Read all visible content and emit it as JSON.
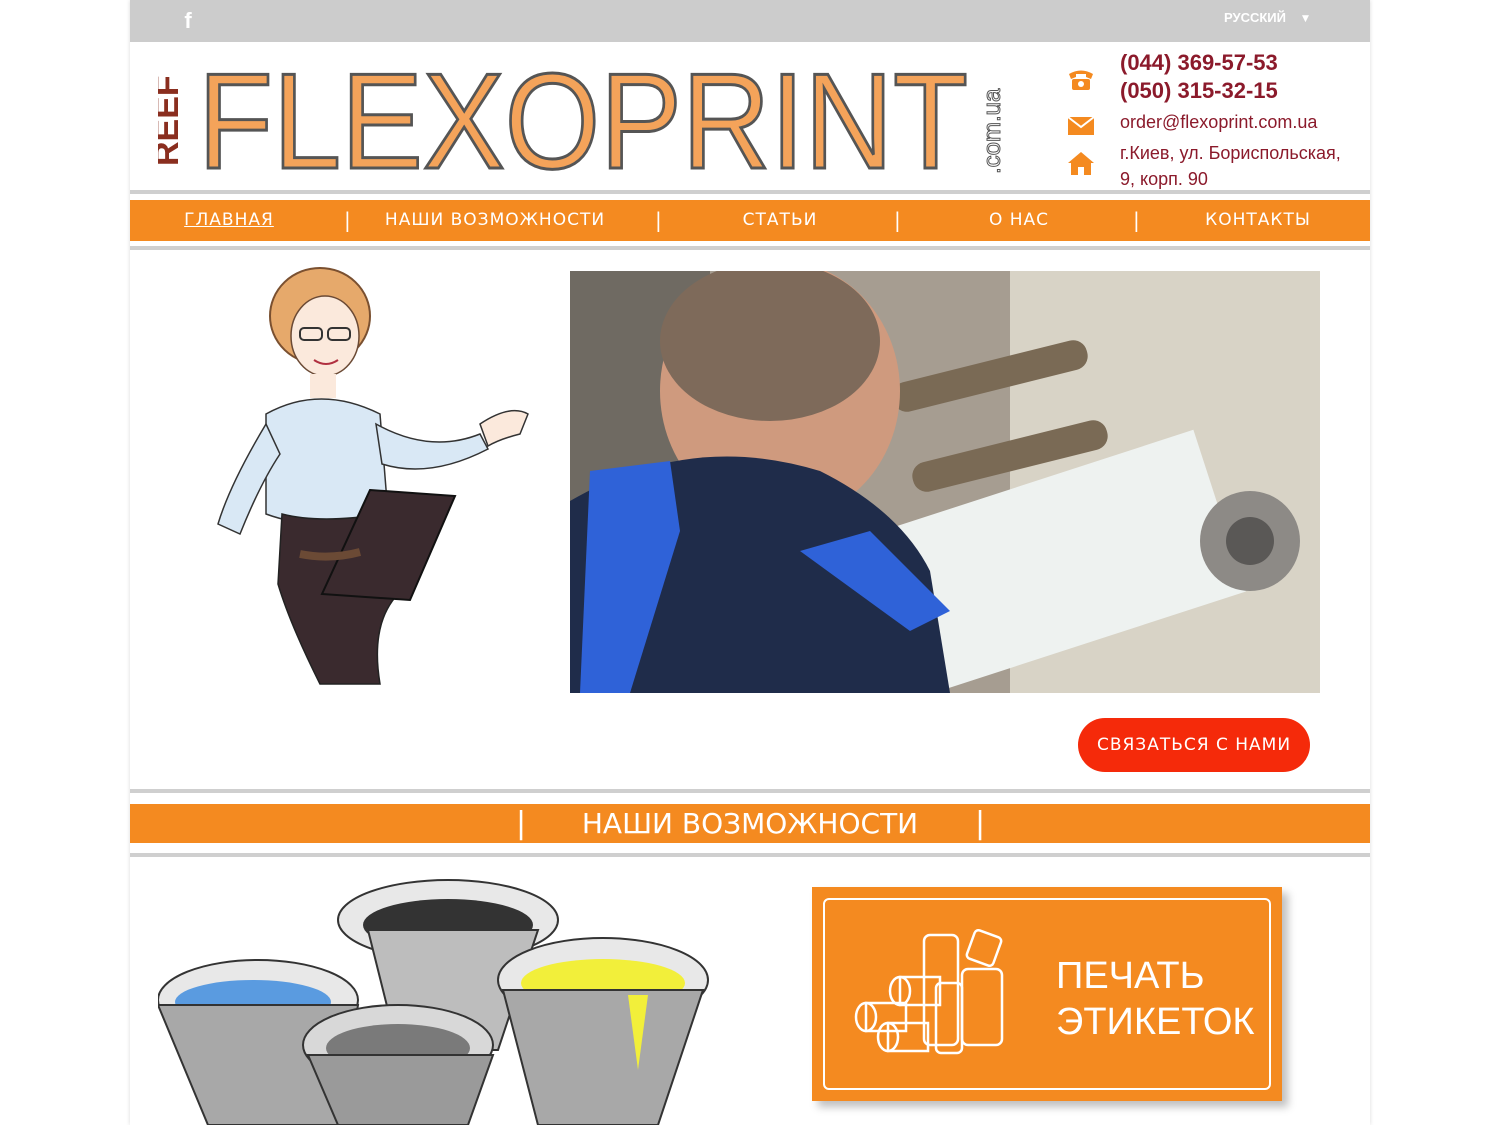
{
  "topbar": {
    "social_icon": "facebook-icon",
    "social_glyph": "f",
    "language": "РУССКИЙ"
  },
  "logo": {
    "prefix": "REEF",
    "brand": "FLEXOPRINT",
    "domain": ".com.ua"
  },
  "contacts": {
    "phone1": "(044) 369-57-53",
    "phone2": "(050) 315-32-15",
    "email": "order@flexoprint.com.ua",
    "address": "г.Киев, ул. Бориспольская, 9, корп. 90"
  },
  "nav": {
    "items": [
      "ГЛАВНАЯ",
      "НАШИ ВОЗМОЖНОСТИ",
      "СТАТЬИ",
      "О НАС",
      "КОНТАКТЫ"
    ],
    "separator": "|"
  },
  "hero": {
    "cta_label": "СВЯЗАТЬСЯ С НАМИ"
  },
  "section": {
    "title": "НАШИ ВОЗМОЖНОСТИ",
    "bar": "|"
  },
  "card": {
    "line1": "ПЕЧАТЬ",
    "line2": "ЭТИКЕТОК"
  },
  "colors": {
    "orange": "#f48a20",
    "cta_red": "#f52a0a",
    "contact_red": "#8b1a2b",
    "topbar_grey": "#cccccc"
  }
}
